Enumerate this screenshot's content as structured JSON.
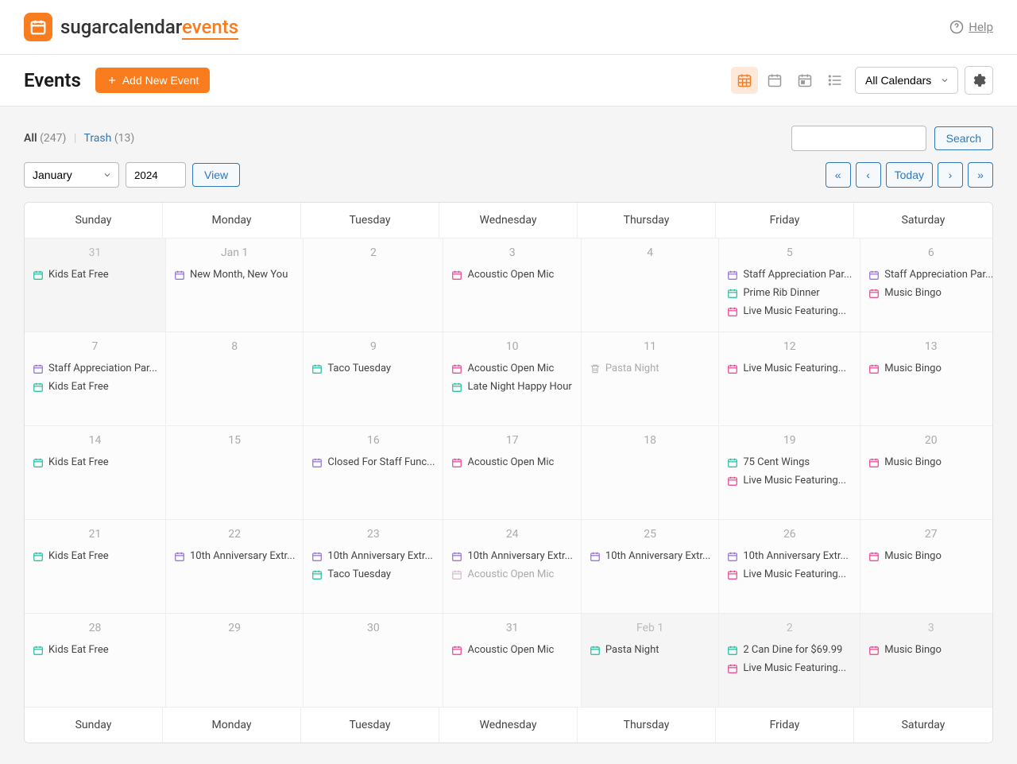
{
  "brand": {
    "prefix": "sugarcalendar",
    "suffix": "events"
  },
  "help_label": "Help",
  "page_title": "Events",
  "add_button": "Add New Event",
  "calendar_filter": "All Calendars",
  "filters": {
    "all_label": "All",
    "all_count": "(247)",
    "separator": "|",
    "trash_label": "Trash",
    "trash_count": "(13)"
  },
  "search_button": "Search",
  "nav": {
    "month": "January",
    "year": "2024",
    "view_button": "View",
    "today_button": "Today",
    "first": "«",
    "prev": "‹",
    "next": "›",
    "last": "»"
  },
  "day_headers": [
    "Sunday",
    "Monday",
    "Tuesday",
    "Wednesday",
    "Thursday",
    "Friday",
    "Saturday"
  ],
  "colors": {
    "teal": "#1abc9c",
    "purple": "#8e6bd1",
    "pink": "#e83e8c",
    "gray": "#b7b7b7"
  },
  "weeks": [
    [
      {
        "date": "31",
        "out": true,
        "events": [
          {
            "c": "teal",
            "t": "Kids Eat Free"
          }
        ]
      },
      {
        "date": "Jan 1",
        "events": [
          {
            "c": "purple",
            "t": "New Month, New You"
          }
        ]
      },
      {
        "date": "2",
        "events": []
      },
      {
        "date": "3",
        "events": [
          {
            "c": "pink",
            "t": "Acoustic Open Mic"
          }
        ]
      },
      {
        "date": "4",
        "events": []
      },
      {
        "date": "5",
        "events": [
          {
            "c": "purple",
            "t": "Staff Appreciation Par..."
          },
          {
            "c": "teal",
            "t": "Prime Rib Dinner"
          },
          {
            "c": "pink",
            "t": "Live Music Featuring..."
          }
        ]
      },
      {
        "date": "6",
        "events": [
          {
            "c": "purple",
            "t": "Staff Appreciation Par..."
          },
          {
            "c": "pink",
            "t": "Music Bingo"
          }
        ]
      }
    ],
    [
      {
        "date": "7",
        "events": [
          {
            "c": "purple",
            "t": "Staff Appreciation Par..."
          },
          {
            "c": "teal",
            "t": "Kids Eat Free"
          }
        ]
      },
      {
        "date": "8",
        "events": []
      },
      {
        "date": "9",
        "events": [
          {
            "c": "teal",
            "t": "Taco Tuesday"
          }
        ]
      },
      {
        "date": "10",
        "events": [
          {
            "c": "pink",
            "t": "Acoustic Open Mic"
          },
          {
            "c": "teal",
            "t": "Late Night Happy Hour"
          }
        ]
      },
      {
        "date": "11",
        "events": [
          {
            "c": "gray",
            "t": "Pasta Night",
            "trash": true,
            "muted": true
          }
        ]
      },
      {
        "date": "12",
        "events": [
          {
            "c": "pink",
            "t": "Live Music Featuring..."
          }
        ]
      },
      {
        "date": "13",
        "events": [
          {
            "c": "pink",
            "t": "Music Bingo"
          }
        ]
      }
    ],
    [
      {
        "date": "14",
        "events": [
          {
            "c": "teal",
            "t": "Kids Eat Free"
          }
        ]
      },
      {
        "date": "15",
        "events": []
      },
      {
        "date": "16",
        "events": [
          {
            "c": "purple",
            "t": "Closed For Staff Func..."
          }
        ]
      },
      {
        "date": "17",
        "events": [
          {
            "c": "pink",
            "t": "Acoustic Open Mic"
          }
        ]
      },
      {
        "date": "18",
        "events": []
      },
      {
        "date": "19",
        "events": [
          {
            "c": "teal",
            "t": "75 Cent Wings"
          },
          {
            "c": "pink",
            "t": "Live Music Featuring..."
          }
        ]
      },
      {
        "date": "20",
        "events": [
          {
            "c": "pink",
            "t": "Music Bingo"
          }
        ]
      }
    ],
    [
      {
        "date": "21",
        "events": [
          {
            "c": "teal",
            "t": "Kids Eat Free"
          }
        ]
      },
      {
        "date": "22",
        "events": [
          {
            "c": "purple",
            "t": "10th Anniversary Extr..."
          }
        ]
      },
      {
        "date": "23",
        "events": [
          {
            "c": "purple",
            "t": "10th Anniversary Extr..."
          },
          {
            "c": "teal",
            "t": "Taco Tuesday"
          }
        ]
      },
      {
        "date": "24",
        "events": [
          {
            "c": "purple",
            "t": "10th Anniversary Extr..."
          },
          {
            "c": "pink",
            "t": "Acoustic Open Mic",
            "muted": true
          }
        ]
      },
      {
        "date": "25",
        "events": [
          {
            "c": "purple",
            "t": "10th Anniversary Extr..."
          }
        ]
      },
      {
        "date": "26",
        "events": [
          {
            "c": "purple",
            "t": "10th Anniversary Extr..."
          },
          {
            "c": "pink",
            "t": "Live Music Featuring..."
          }
        ]
      },
      {
        "date": "27",
        "events": [
          {
            "c": "pink",
            "t": "Music Bingo"
          }
        ]
      }
    ],
    [
      {
        "date": "28",
        "events": [
          {
            "c": "teal",
            "t": "Kids Eat Free"
          }
        ]
      },
      {
        "date": "29",
        "events": []
      },
      {
        "date": "30",
        "events": []
      },
      {
        "date": "31",
        "events": [
          {
            "c": "pink",
            "t": "Acoustic Open Mic"
          }
        ]
      },
      {
        "date": "Feb 1",
        "out": true,
        "events": [
          {
            "c": "teal",
            "t": "Pasta Night"
          }
        ]
      },
      {
        "date": "2",
        "out": true,
        "events": [
          {
            "c": "teal",
            "t": "2 Can Dine for $69.99"
          },
          {
            "c": "pink",
            "t": "Live Music Featuring..."
          }
        ]
      },
      {
        "date": "3",
        "out": true,
        "events": [
          {
            "c": "pink",
            "t": "Music Bingo"
          }
        ]
      }
    ]
  ]
}
